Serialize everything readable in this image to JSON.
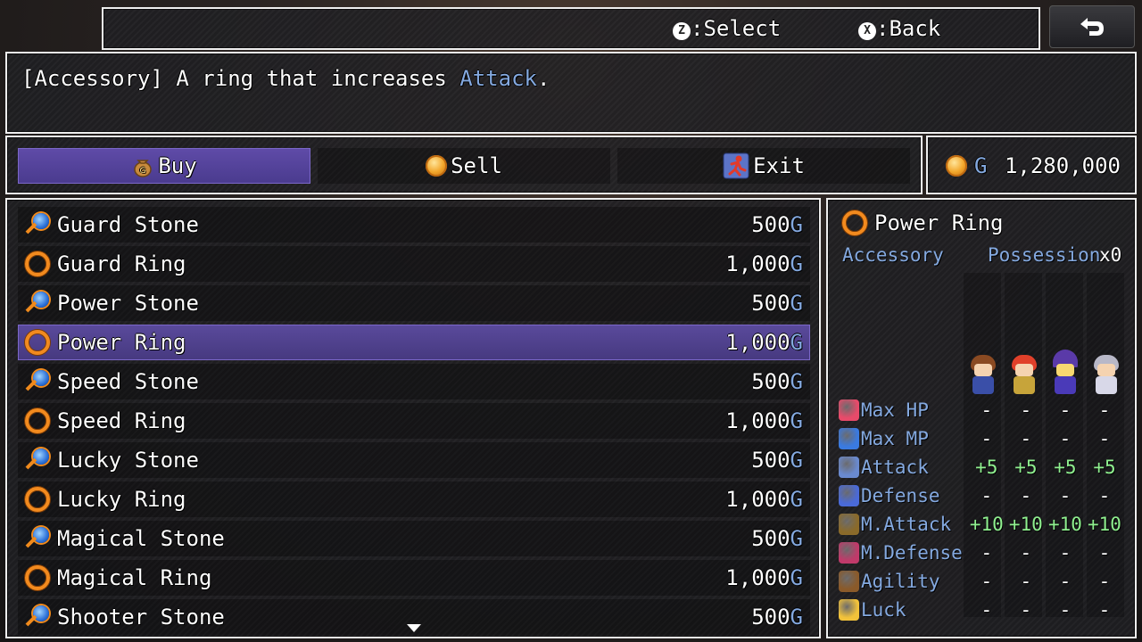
{
  "help_bar": {
    "select_key": "Z",
    "select_label": ":Select",
    "back_key": "X",
    "back_label": ":Back",
    "back_icon": "undo-arrow-icon"
  },
  "description": {
    "prefix": "[Accessory] A ring that increases ",
    "keyword": "Attack",
    "suffix": "."
  },
  "commands": [
    {
      "label": "Buy",
      "icon": "money-bag-icon"
    },
    {
      "label": "Sell",
      "icon": "coin-icon"
    },
    {
      "label": "Exit",
      "icon": "running-man-icon"
    }
  ],
  "gold": {
    "unit": "G",
    "amount": "1,280,000"
  },
  "items": [
    {
      "name": "Guard Stone",
      "price": "500",
      "icon": "stone-icon"
    },
    {
      "name": "Guard Ring",
      "price": "1,000",
      "icon": "ring-icon"
    },
    {
      "name": "Power Stone",
      "price": "500",
      "icon": "stone-icon"
    },
    {
      "name": "Power Ring",
      "price": "1,000",
      "icon": "ring-icon"
    },
    {
      "name": "Speed Stone",
      "price": "500",
      "icon": "stone-icon"
    },
    {
      "name": "Speed Ring",
      "price": "1,000",
      "icon": "ring-icon"
    },
    {
      "name": "Lucky Stone",
      "price": "500",
      "icon": "stone-icon"
    },
    {
      "name": "Lucky Ring",
      "price": "1,000",
      "icon": "ring-icon"
    },
    {
      "name": "Magical Stone",
      "price": "500",
      "icon": "stone-icon"
    },
    {
      "name": "Magical Ring",
      "price": "1,000",
      "icon": "ring-icon"
    },
    {
      "name": "Shooter Stone",
      "price": "500",
      "icon": "stone-icon"
    }
  ],
  "price_unit": "G",
  "status": {
    "item_name": "Power Ring",
    "type": "Accessory",
    "possession_label": "Possession",
    "possession_value": "x0",
    "stats": [
      {
        "label": "Max HP",
        "icon": "heart-icon",
        "values": [
          "-",
          "-",
          "-",
          "-"
        ]
      },
      {
        "label": "Max MP",
        "icon": "orb-icon",
        "values": [
          "-",
          "-",
          "-",
          "-"
        ]
      },
      {
        "label": "Attack",
        "icon": "attack-icon",
        "values": [
          "+5",
          "+5",
          "+5",
          "+5"
        ]
      },
      {
        "label": "Defense",
        "icon": "shield-icon",
        "values": [
          "-",
          "-",
          "-",
          "-"
        ]
      },
      {
        "label": "M.Attack",
        "icon": "wand-icon",
        "values": [
          "+10",
          "+10",
          "+10",
          "+10"
        ]
      },
      {
        "label": "M.Defense",
        "icon": "hat-icon",
        "values": [
          "-",
          "-",
          "-",
          "-"
        ]
      },
      {
        "label": "Agility",
        "icon": "boot-icon",
        "values": [
          "-",
          "-",
          "-",
          "-"
        ]
      },
      {
        "label": "Luck",
        "icon": "star-icon",
        "values": [
          "-",
          "-",
          "-",
          "-"
        ]
      }
    ]
  },
  "colors": {
    "system_blue": "#84a9e0",
    "gain_green": "#8ff08f",
    "cursor_purple": "#5a4a9c"
  }
}
